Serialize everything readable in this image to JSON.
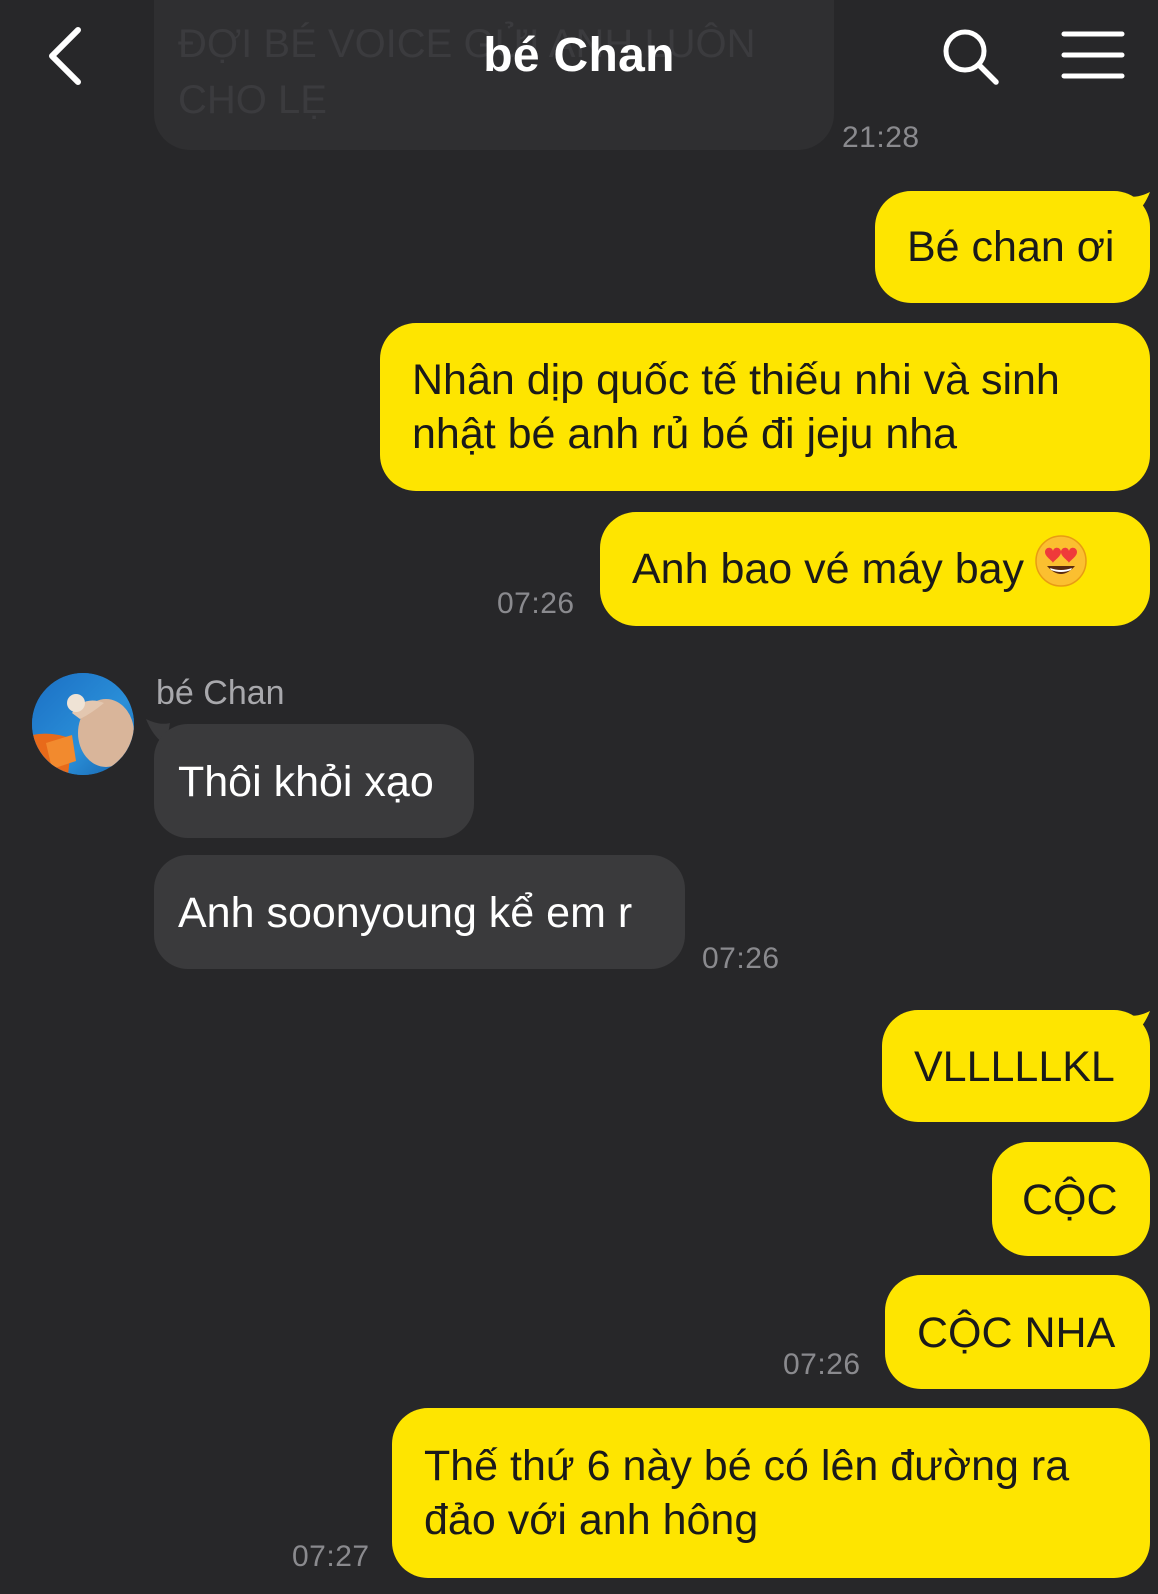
{
  "header": {
    "title": "bé Chan",
    "back_icon": "chevron-left-icon",
    "search_icon": "search-icon",
    "menu_icon": "hamburger-menu-icon"
  },
  "colors": {
    "background": "#272729",
    "sent_bubble": "#fee500",
    "received_bubble": "#3a3a3c",
    "timestamp": "#8a8a8e"
  },
  "previous_message": {
    "text": "ĐỢI BÉ VOICE GỬI ANH LUÔN\nCHO LẸ",
    "time": "21:28"
  },
  "messages": {
    "m1": {
      "from": "me",
      "text": "Bé chan ơi"
    },
    "m2": {
      "from": "me",
      "text": "Nhân dịp quốc tế thiếu nhi và sinh nhật bé anh rủ bé đi jeju nha"
    },
    "m3": {
      "from": "me",
      "text": "Anh bao vé máy bay",
      "emoji": "heart-eyes-emoji",
      "time": "07:26"
    },
    "m4": {
      "from": "bé Chan",
      "text": "Thôi khỏi xạo"
    },
    "m5": {
      "from": "bé Chan",
      "text": "Anh soonyoung kể em r",
      "time": "07:26"
    },
    "m6": {
      "from": "me",
      "text": "VLLLLLKL"
    },
    "m7": {
      "from": "me",
      "text": "CỘC"
    },
    "m8": {
      "from": "me",
      "text": "CỘC NHA",
      "time": "07:26"
    },
    "m9": {
      "from": "me",
      "text": "Thế thứ 6 này bé có lên đường ra đảo với anh hông",
      "time": "07:27"
    }
  },
  "contact": {
    "name": "bé Chan",
    "avatar": "avatar-photo"
  }
}
